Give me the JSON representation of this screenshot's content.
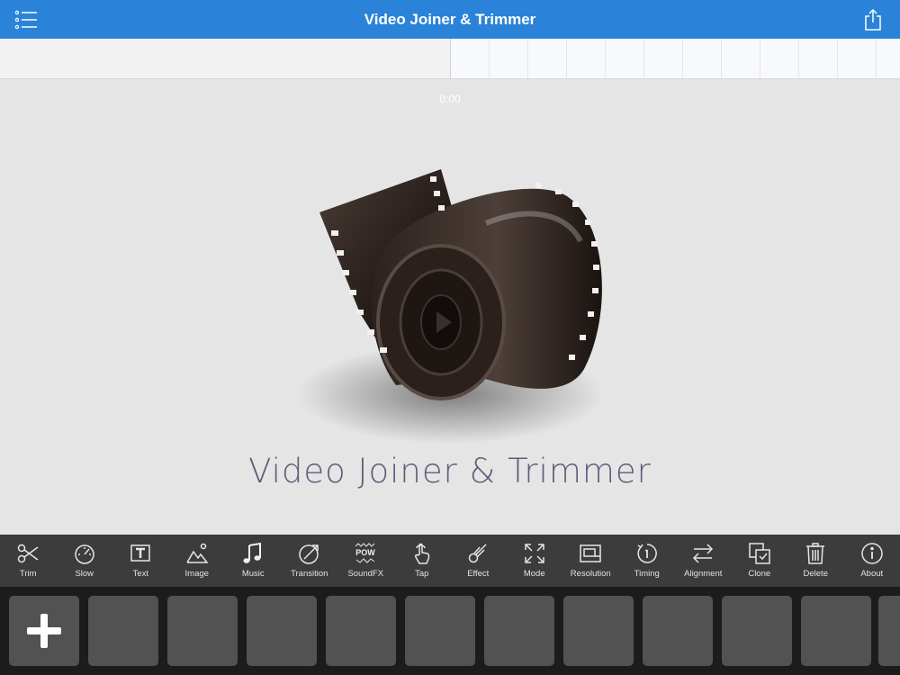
{
  "header": {
    "title": "Video Joiner & Trimmer",
    "menu_icon": "list-menu-icon",
    "share_icon": "share-icon"
  },
  "preview": {
    "time": "0:00",
    "title": "Video Joiner & Trimmer",
    "artwork": "film-reel-illustration"
  },
  "toolbar": {
    "items": [
      {
        "label": "Trim",
        "icon": "scissors-icon"
      },
      {
        "label": "Slow",
        "icon": "speedometer-icon"
      },
      {
        "label": "Text",
        "icon": "text-box-icon"
      },
      {
        "label": "Image",
        "icon": "image-mountains-icon"
      },
      {
        "label": "Music",
        "icon": "music-note-icon"
      },
      {
        "label": "Transition",
        "icon": "transition-icon"
      },
      {
        "label": "SoundFX",
        "icon": "soundfx-icon"
      },
      {
        "label": "Tap",
        "icon": "tap-hand-icon"
      },
      {
        "label": "Effect",
        "icon": "effect-comet-icon"
      },
      {
        "label": "Mode",
        "icon": "expand-arrows-icon"
      },
      {
        "label": "Resolution",
        "icon": "resolution-icon"
      },
      {
        "label": "Timing",
        "icon": "timer-icon"
      },
      {
        "label": "Alignment",
        "icon": "swap-arrows-icon"
      },
      {
        "label": "Clone",
        "icon": "clone-icon"
      },
      {
        "label": "Delete",
        "icon": "trash-icon"
      },
      {
        "label": "About",
        "icon": "info-icon"
      }
    ],
    "soundfx_glyph": "POW"
  },
  "tray": {
    "add_icon": "plus-icon",
    "empty_slots": 11
  },
  "colors": {
    "nav_bar": "#2a83d8",
    "toolbar": "#3c3c3c",
    "tray": "#1c1c1c",
    "slot": "#525252",
    "preview_bg": "#e5e5e5",
    "title_text": "#5d5d7a"
  }
}
